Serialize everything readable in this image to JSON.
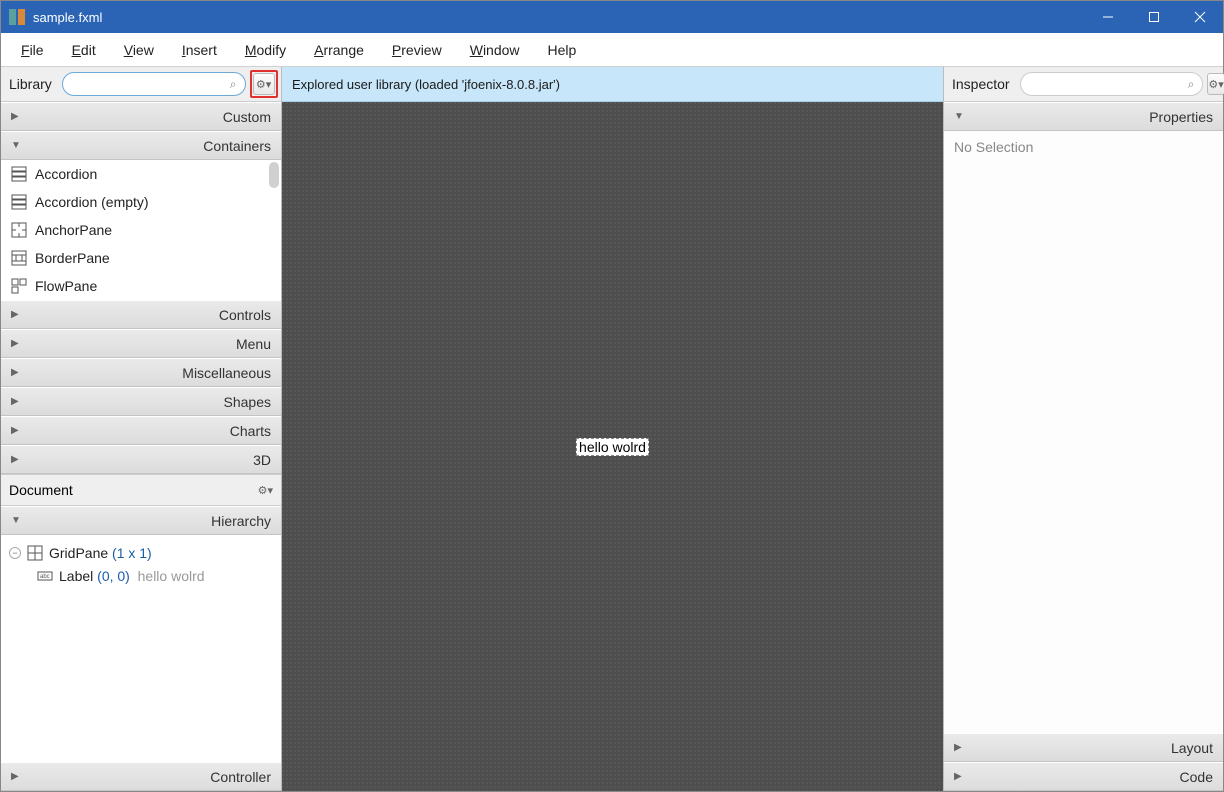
{
  "window": {
    "title": "sample.fxml"
  },
  "menu": {
    "file": "File",
    "edit": "Edit",
    "view": "View",
    "insert": "Insert",
    "modify": "Modify",
    "arrange": "Arrange",
    "preview": "Preview",
    "window": "Window",
    "help": "Help"
  },
  "library": {
    "title": "Library",
    "search_value": "",
    "search_placeholder": "",
    "sections": {
      "custom": "Custom",
      "containers": "Containers",
      "controls": "Controls",
      "menu": "Menu",
      "misc": "Miscellaneous",
      "shapes": "Shapes",
      "charts": "Charts",
      "three_d": "3D"
    },
    "items": [
      {
        "name": "Accordion",
        "icon": "accordion-icon"
      },
      {
        "name": "Accordion  (empty)",
        "icon": "accordion-icon"
      },
      {
        "name": "AnchorPane",
        "icon": "anchorpane-icon"
      },
      {
        "name": "BorderPane",
        "icon": "borderpane-icon"
      },
      {
        "name": "FlowPane",
        "icon": "flowpane-icon"
      }
    ]
  },
  "document": {
    "title": "Document",
    "hierarchy_label": "Hierarchy",
    "controller_label": "Controller",
    "tree": {
      "root": "GridPane ",
      "root_dims": "(1 x 1)",
      "child": "Label ",
      "child_pos": "(0, 0)",
      "child_text": "hello wolrd"
    }
  },
  "center": {
    "banner": "Explored user library (loaded 'jfoenix-8.0.8.jar')",
    "canvas_label": "hello wolrd"
  },
  "inspector": {
    "title": "Inspector",
    "properties_label": "Properties",
    "layout_label": "Layout",
    "code_label": "Code",
    "body": "No Selection"
  }
}
